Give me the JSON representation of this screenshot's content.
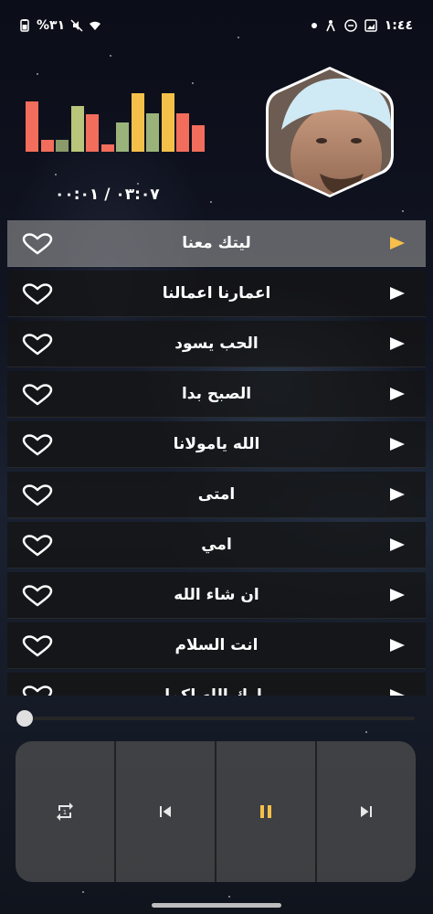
{
  "status_bar": {
    "battery_percent": "%٣١",
    "time": "١:٤٤"
  },
  "player": {
    "time_display": "٠٣:٠٧ / ٠٠:٠١",
    "progress": 0,
    "equalizer_colors": [
      "#f26d5b",
      "#f26d5b",
      "#8a9a6b",
      "#b8c57a",
      "#f26d5b",
      "#f26d5b",
      "#9ab37a",
      "#f5c04a",
      "#9ab37a",
      "#f5c04a",
      "#f26d5b",
      "#f26d5b"
    ],
    "equalizer_levels": [
      0.78,
      0.18,
      0.18,
      0.72,
      0.58,
      0.12,
      0.45,
      0.92,
      0.6,
      0.92,
      0.6,
      0.42
    ]
  },
  "tracks": [
    {
      "title": "ليتك معنا",
      "active": true
    },
    {
      "title": "اعمارنا اعمالنا",
      "active": false
    },
    {
      "title": "الحب يسود",
      "active": false
    },
    {
      "title": "الصبح بدا",
      "active": false
    },
    {
      "title": "الله يامولانا",
      "active": false
    },
    {
      "title": "امتى",
      "active": false
    },
    {
      "title": "امي",
      "active": false
    },
    {
      "title": "ان شاء الله",
      "active": false
    },
    {
      "title": "انت السلام",
      "active": false
    },
    {
      "title": "بارك الله لكما",
      "active": false
    }
  ],
  "colors": {
    "accent": "#f5c04a",
    "row_bg": "#141414",
    "active_row_bg": "#969696"
  },
  "controls": [
    "repeat-icon",
    "skip-previous-icon",
    "pause-icon",
    "skip-next-icon"
  ]
}
